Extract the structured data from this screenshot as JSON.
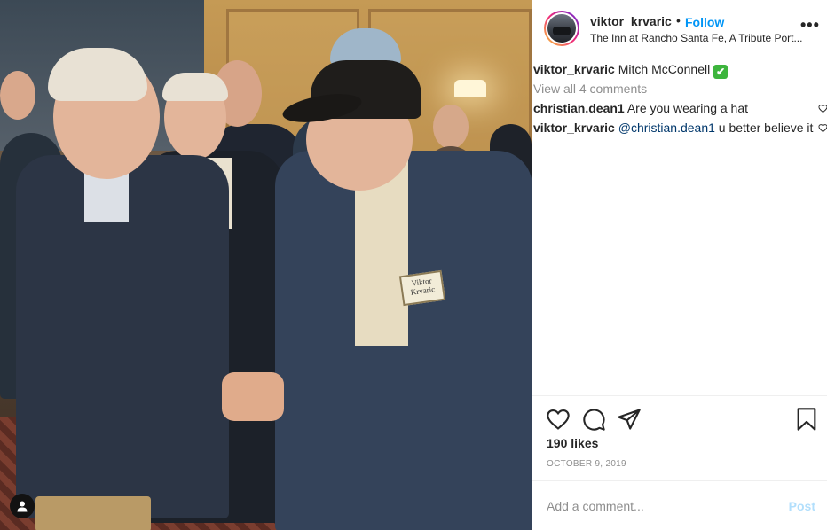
{
  "post": {
    "photo_alt": "",
    "username": "viktor_krvaric",
    "follow_label": "Follow",
    "dot": "•",
    "location": "The Inn at Rancho Santa Fe, A Tribute Port...",
    "more_label": "•••",
    "nametag_line1": "Viktor",
    "nametag_line2": "Krvaric"
  },
  "caption": {
    "username": "viktor_krvaric",
    "text": "Mitch McConnell",
    "emoji": "✔"
  },
  "view_all_comments": "View all 4 comments",
  "comments": [
    {
      "username": "christian.dean1",
      "mention": "",
      "text": "Are you wearing a hat"
    },
    {
      "username": "viktor_krvaric",
      "mention": "@christian.dean1",
      "text": "u better believe it"
    }
  ],
  "actions": {
    "likes": "190 likes",
    "date": "OCTOBER 9, 2019",
    "icons": [
      "heart-icon",
      "comment-icon",
      "share-icon",
      "bookmark-icon"
    ]
  },
  "comment_box": {
    "placeholder": "Add a comment...",
    "post_label": "Post"
  },
  "colors": {
    "accent": "#0095f6",
    "post_disabled": "#b2dffc",
    "muted": "#8e8e8e",
    "mention": "#00376b"
  }
}
